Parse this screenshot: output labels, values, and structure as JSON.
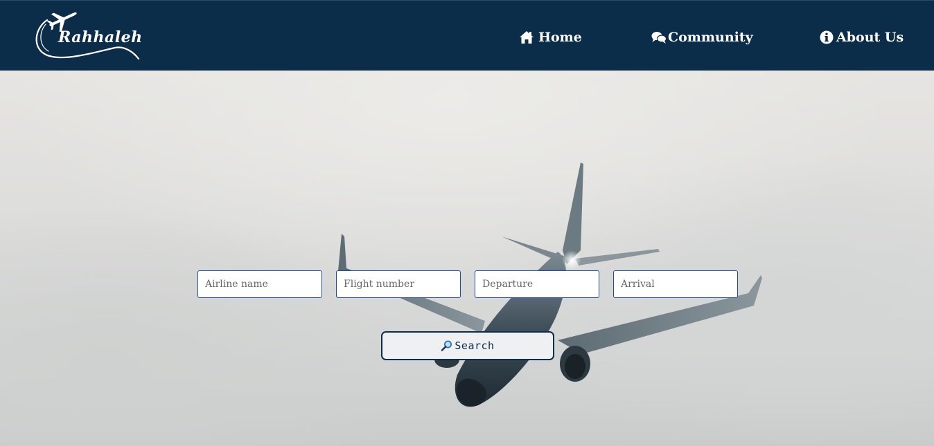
{
  "brand": {
    "name": "Rahhaleh",
    "logo_icon": "airplane-swoosh-logo"
  },
  "nav": {
    "items": [
      {
        "label": "Home",
        "icon": "home-icon"
      },
      {
        "label": "Community",
        "icon": "chat-bubbles-icon"
      },
      {
        "label": "About Us",
        "icon": "info-circle-icon"
      }
    ]
  },
  "search_form": {
    "airline_placeholder": "Airline name",
    "flight_number_placeholder": "Flight number",
    "departure_placeholder": "Departure",
    "arrival_placeholder": "Arrival",
    "search_label": "Search",
    "search_icon": "magnifier-icon"
  },
  "colors": {
    "navbar": "#0b2d4a",
    "field_border": "#1d4e8f",
    "button_bg": "#eff0f2"
  }
}
